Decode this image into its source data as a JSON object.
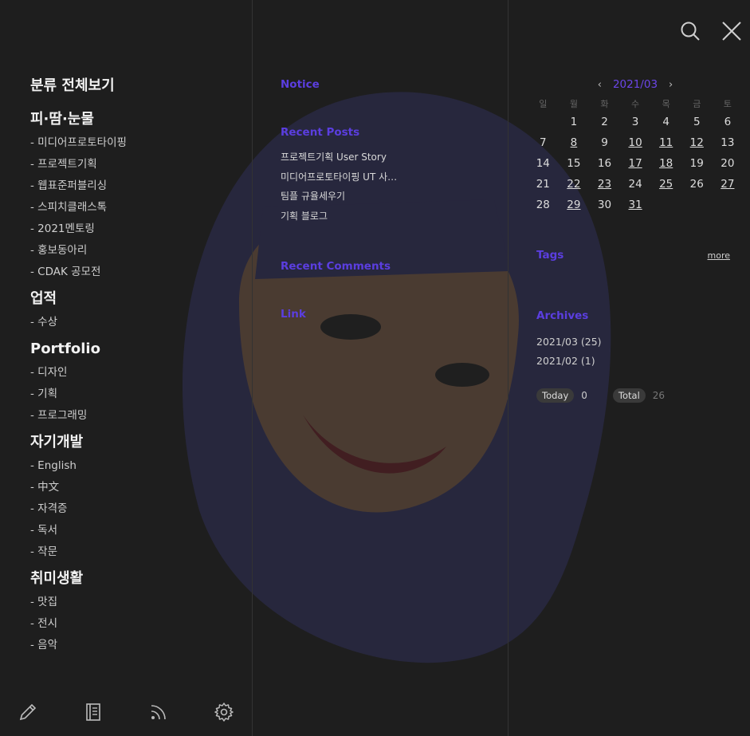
{
  "categories": {
    "all_label": "분류 전체보기",
    "groups": [
      {
        "title": "피·땀·눈물",
        "items": [
          "- 미디어프로토타이핑",
          "- 프로젝트기획",
          "- 웹표준퍼블리싱",
          "- 스피치클래스톡",
          "- 2021멘토링",
          "- 홍보동아리",
          "- CDAK 공모전"
        ]
      },
      {
        "title": "업적",
        "items": [
          "- 수상"
        ]
      },
      {
        "title": "Portfolio",
        "items": [
          "- 디자인",
          "- 기획",
          "- 프로그래밍"
        ]
      },
      {
        "title": "자기개발",
        "items": [
          "- English",
          "- 中文",
          "- 자격증",
          "- 독서",
          "- 작문"
        ]
      },
      {
        "title": "취미생활",
        "items": [
          "- 맛집",
          "- 전시",
          "- 음악"
        ]
      }
    ]
  },
  "widgets": {
    "notice_title": "Notice",
    "recent_posts_title": "Recent Posts",
    "recent_posts": [
      "프로젝트기획 User Story",
      "미디어프로토타이핑 UT 사전 준비",
      "팀플 규율세우기",
      "기획 블로그"
    ],
    "recent_comments_title": "Recent Comments",
    "link_title": "Link"
  },
  "calendar": {
    "month_label": "2021/03",
    "prev": "‹",
    "next": "›",
    "weekdays": [
      "일",
      "월",
      "화",
      "수",
      "목",
      "금",
      "토"
    ],
    "weeks": [
      [
        "",
        "1",
        "2",
        "3",
        "4",
        "5",
        "6"
      ],
      [
        "7",
        "8",
        "9",
        "10",
        "11",
        "12",
        "13"
      ],
      [
        "14",
        "15",
        "16",
        "17",
        "18",
        "19",
        "20"
      ],
      [
        "21",
        "22",
        "23",
        "24",
        "25",
        "26",
        "27"
      ],
      [
        "28",
        "29",
        "30",
        "31",
        "",
        "",
        ""
      ]
    ],
    "linked_days": [
      "8",
      "10",
      "11",
      "12",
      "17",
      "18",
      "22",
      "23",
      "25",
      "27",
      "29",
      "31"
    ]
  },
  "tags": {
    "title": "Tags",
    "more_label": "more"
  },
  "archives": {
    "title": "Archives",
    "items": [
      "2021/03 (25)",
      "2021/02 (1)"
    ]
  },
  "stats": {
    "today_label": "Today",
    "today_value": "0",
    "total_label": "Total",
    "total_value": "26"
  },
  "colors": {
    "accent": "#5b3ee0",
    "background": "#1e1e1e"
  },
  "icons": {
    "top": [
      "search-icon",
      "close-icon"
    ],
    "bottom": [
      "pencil-icon",
      "notebook-icon",
      "rss-icon",
      "gear-icon"
    ]
  }
}
